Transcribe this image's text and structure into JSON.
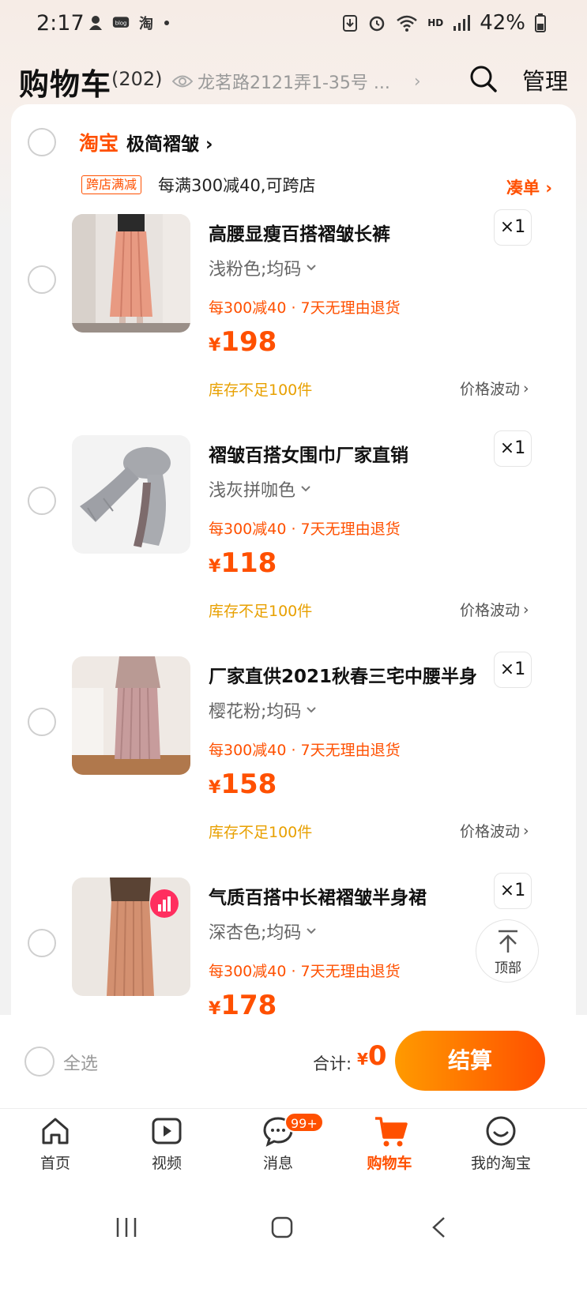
{
  "status_bar": {
    "time": "2:17",
    "battery": "42%",
    "hd": "HD",
    "left_icons": [
      "notification-icon",
      "blog-icon",
      "taobao-icon",
      "dot-icon"
    ],
    "right_icons": [
      "download-icon",
      "alarm-icon",
      "wifi-icon",
      "signal-icon",
      "battery-icon"
    ]
  },
  "header": {
    "title": "购物车",
    "count": "(202)",
    "address": "龙茗路2121弄1-35号 ...",
    "manage": "管理"
  },
  "shop": {
    "platform": "淘宝",
    "name": "极简褶皱",
    "promo_tag": "跨店满减",
    "promo_text": "每满300减40,可跨店",
    "collect": "凑单"
  },
  "items": [
    {
      "name": "高腰显瘦百搭褶皱长裤",
      "sku": "浅粉色;均码",
      "service": "每300减40 · 7天无理由退货",
      "price_symbol": "¥",
      "price": "198",
      "quantity": "×1",
      "stock": "库存不足100件",
      "fluctuation": "价格波动"
    },
    {
      "name": "褶皱百搭女围巾厂家直销",
      "sku": "浅灰拼咖色",
      "service": "每300减40 · 7天无理由退货",
      "price_symbol": "¥",
      "price": "118",
      "quantity": "×1",
      "stock": "库存不足100件",
      "fluctuation": "价格波动"
    },
    {
      "name": "厂家直供2021秋春三宅中腰半身",
      "sku": "樱花粉;均码",
      "service": "每300减40 · 7天无理由退货",
      "price_symbol": "¥",
      "price": "158",
      "quantity": "×1",
      "stock": "库存不足100件",
      "fluctuation": "价格波动"
    },
    {
      "name": "气质百搭中长裙褶皱半身裙",
      "sku": "深杏色;均码",
      "service": "每300减40 · 7天无理由退货",
      "price_symbol": "¥",
      "price": "178",
      "quantity": "×1"
    }
  ],
  "back_to_top": "顶部",
  "checkout": {
    "select_all": "全选",
    "total_label": "合计:",
    "total_symbol": "¥",
    "total_value": "0",
    "pay_button": "结算"
  },
  "tabs": [
    {
      "label": "首页",
      "icon": "home-icon"
    },
    {
      "label": "视频",
      "icon": "video-icon"
    },
    {
      "label": "消息",
      "icon": "message-icon",
      "badge": "99+"
    },
    {
      "label": "购物车",
      "icon": "cart-icon",
      "active": true
    },
    {
      "label": "我的淘宝",
      "icon": "profile-icon"
    }
  ],
  "colors": {
    "accent": "#ff5000",
    "stock_warning": "#e8a000",
    "pay_gradient_start": "#ff9a00",
    "pay_gradient_end": "#ff5000"
  }
}
